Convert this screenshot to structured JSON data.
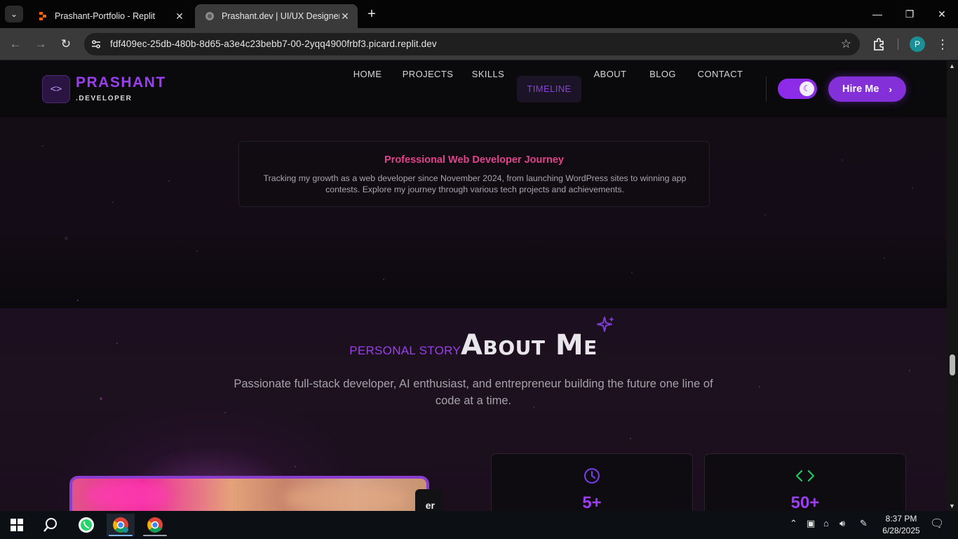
{
  "browser": {
    "tabs": [
      {
        "title": "Prashant-Portfolio - Replit",
        "active": false
      },
      {
        "title": "Prashant.dev | UI/UX Designer &",
        "active": true
      }
    ],
    "url": "fdf409ec-25db-480b-8d65-a3e4c23bebb7-00-2yqq4900frbf3.picard.replit.dev",
    "profile_initial": "P"
  },
  "site": {
    "logo_symbol": "<>",
    "logo_name": "PRASHANT",
    "logo_sub": ".DEVELOPER",
    "nav": [
      "HOME",
      "PROJECTS",
      "SKILLS",
      "TIMELINE",
      "ABOUT",
      "BLOG",
      "CONTACT"
    ],
    "active_nav": "TIMELINE",
    "theme_mode": "dark",
    "hire_label": "Hire Me",
    "accent_color": "#8b32e0"
  },
  "timeline": {
    "card_title": "Professional Web Developer Journey",
    "card_text": "Tracking my growth as a web developer since November 2024, from launching WordPress sites to winning app contests. Explore my journey through various tech projects and achievements."
  },
  "about": {
    "eyebrow": "PERSONAL STORY",
    "title": "About Me",
    "description": "Passionate full-stack developer, AI enthusiast, and entrepreneur building the future one line of code at a time.",
    "photo_tag": "er",
    "stats": [
      {
        "icon": "clock-icon",
        "value": "5+",
        "icon_color": "#7b3ff0"
      },
      {
        "icon": "code-icon",
        "value": "50+",
        "icon_color": "#22c55e"
      }
    ]
  },
  "taskbar": {
    "time": "8:37 PM",
    "date": "6/28/2025"
  }
}
